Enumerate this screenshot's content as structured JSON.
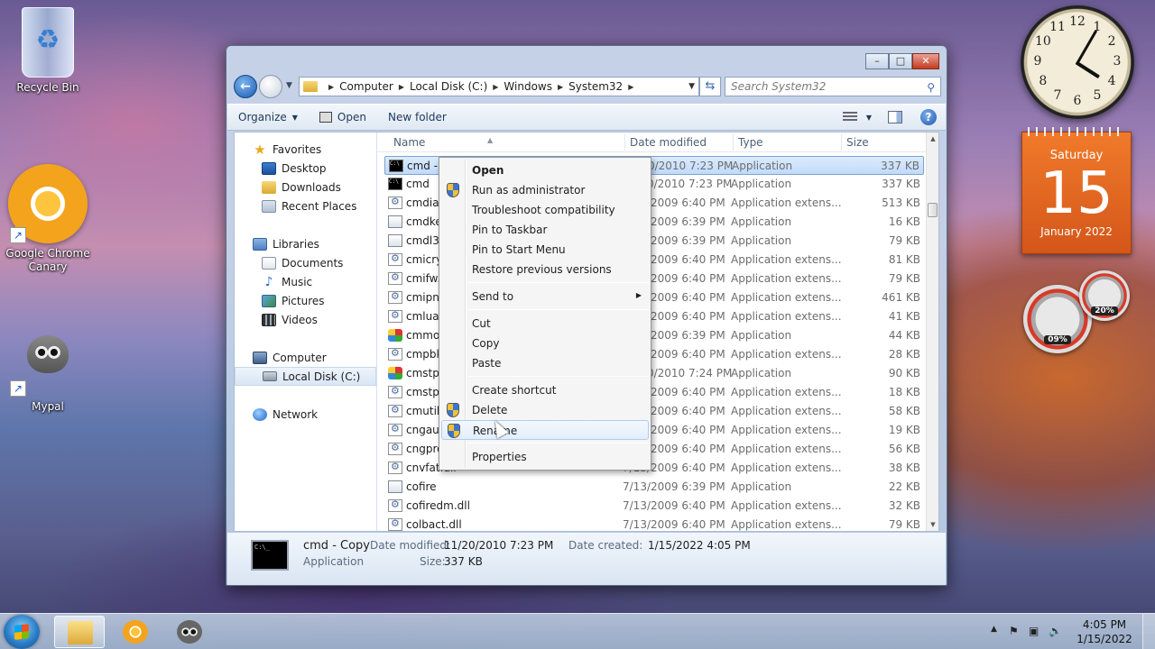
{
  "desktop": {
    "icons": [
      {
        "label": "Recycle Bin"
      },
      {
        "label": "Google Chrome Canary"
      },
      {
        "label": "Mypal"
      }
    ]
  },
  "gadgets": {
    "clock": {
      "numbers": [
        "12",
        "1",
        "2",
        "3",
        "4",
        "5",
        "6",
        "7",
        "8",
        "9",
        "10",
        "11"
      ]
    },
    "calendar": {
      "weekday": "Saturday",
      "day": "15",
      "month_year": "January 2022"
    },
    "meters": {
      "cpu": "09%",
      "memory": "20%"
    }
  },
  "explorer": {
    "caption_buttons": {
      "minimize": "–",
      "maximize": "□",
      "close": "✕"
    },
    "breadcrumb": [
      "Computer",
      "Local Disk (C:)",
      "Windows",
      "System32"
    ],
    "search_placeholder": "Search System32",
    "toolbar": {
      "organize": "Organize",
      "open": "Open",
      "new_folder": "New folder"
    },
    "nav": {
      "favorites": "Favorites",
      "favorites_items": [
        "Desktop",
        "Downloads",
        "Recent Places"
      ],
      "libraries": "Libraries",
      "libraries_items": [
        "Documents",
        "Music",
        "Pictures",
        "Videos"
      ],
      "computer": "Computer",
      "computer_items": [
        "Local Disk (C:)"
      ],
      "network": "Network"
    },
    "columns": {
      "name": "Name",
      "date": "Date modified",
      "type": "Type",
      "size": "Size"
    },
    "files": [
      {
        "name": "cmd - Copy",
        "date": "11/20/2010 7:23 PM",
        "type": "Application",
        "size": "337 KB",
        "icon": "cmd-icon",
        "selected": true
      },
      {
        "name": "cmd",
        "date": "11/20/2010 7:23 PM",
        "type": "Application",
        "size": "337 KB",
        "icon": "cmd-icon"
      },
      {
        "name": "cmdial32.dll",
        "date": "7/13/2009 6:40 PM",
        "type": "Application extens...",
        "size": "513 KB",
        "icon": "dll-icon"
      },
      {
        "name": "cmdkey",
        "date": "7/13/2009 6:39 PM",
        "type": "Application",
        "size": "16 KB",
        "icon": "app-icon"
      },
      {
        "name": "cmdl32",
        "date": "7/13/2009 6:39 PM",
        "type": "Application",
        "size": "79 KB",
        "icon": "app-icon"
      },
      {
        "name": "cmicryptinstall.dll",
        "date": "7/13/2009 6:40 PM",
        "type": "Application extens...",
        "size": "81 KB",
        "icon": "dll-icon"
      },
      {
        "name": "cmifw.dll",
        "date": "7/13/2009 6:40 PM",
        "type": "Application extens...",
        "size": "79 KB",
        "icon": "dll-icon"
      },
      {
        "name": "cmipnpinstall.dll",
        "date": "7/13/2009 6:40 PM",
        "type": "Application extens...",
        "size": "461 KB",
        "icon": "dll-icon"
      },
      {
        "name": "cmlua.dll",
        "date": "7/13/2009 6:40 PM",
        "type": "Application extens...",
        "size": "41 KB",
        "icon": "dll-icon"
      },
      {
        "name": "cmmon32",
        "date": "7/13/2009 6:39 PM",
        "type": "Application",
        "size": "44 KB",
        "icon": "color-icon"
      },
      {
        "name": "cmpbk32.dll",
        "date": "7/13/2009 6:40 PM",
        "type": "Application extens...",
        "size": "28 KB",
        "icon": "dll-icon"
      },
      {
        "name": "cmstp",
        "date": "11/20/2010 7:24 PM",
        "type": "Application",
        "size": "90 KB",
        "icon": "color-icon"
      },
      {
        "name": "cmstplua.dll",
        "date": "7/13/2009 6:40 PM",
        "type": "Application extens...",
        "size": "18 KB",
        "icon": "dll-icon"
      },
      {
        "name": "cmutil.dll",
        "date": "7/13/2009 6:40 PM",
        "type": "Application extens...",
        "size": "58 KB",
        "icon": "dll-icon"
      },
      {
        "name": "cngaudit.dll",
        "date": "7/13/2009 6:40 PM",
        "type": "Application extens...",
        "size": "19 KB",
        "icon": "dll-icon"
      },
      {
        "name": "cngprovider.dll",
        "date": "7/13/2009 6:40 PM",
        "type": "Application extens...",
        "size": "56 KB",
        "icon": "dll-icon"
      },
      {
        "name": "cnvfat.dll",
        "date": "7/13/2009 6:40 PM",
        "type": "Application extens...",
        "size": "38 KB",
        "icon": "dll-icon"
      },
      {
        "name": "cofire",
        "date": "7/13/2009 6:39 PM",
        "type": "Application",
        "size": "22 KB",
        "icon": "app-icon"
      },
      {
        "name": "cofiredm.dll",
        "date": "7/13/2009 6:40 PM",
        "type": "Application extens...",
        "size": "32 KB",
        "icon": "dll-icon"
      },
      {
        "name": "colbact.dll",
        "date": "7/13/2009 6:40 PM",
        "type": "Application extens...",
        "size": "79 KB",
        "icon": "dll-icon"
      }
    ],
    "details": {
      "name": "cmd - Copy",
      "kind": "Application",
      "date_modified_label": "Date modified:",
      "date_modified": "11/20/2010 7:23 PM",
      "date_created_label": "Date created:",
      "date_created": "1/15/2022 4:05 PM",
      "size_label": "Size:",
      "size": "337 KB"
    }
  },
  "context_menu": {
    "groups": [
      [
        {
          "label": "Open",
          "bold": true
        },
        {
          "label": "Run as administrator",
          "shield": true
        },
        {
          "label": "Troubleshoot compatibility"
        },
        {
          "label": "Pin to Taskbar"
        },
        {
          "label": "Pin to Start Menu"
        },
        {
          "label": "Restore previous versions"
        }
      ],
      [
        {
          "label": "Send to",
          "submenu": true
        }
      ],
      [
        {
          "label": "Cut"
        },
        {
          "label": "Copy"
        },
        {
          "label": "Paste"
        }
      ],
      [
        {
          "label": "Create shortcut"
        },
        {
          "label": "Delete",
          "shield": true
        },
        {
          "label": "Rename",
          "shield": true,
          "hover": true
        }
      ],
      [
        {
          "label": "Properties"
        }
      ]
    ]
  },
  "taskbar": {
    "time": "4:05 PM",
    "date": "1/15/2022"
  }
}
